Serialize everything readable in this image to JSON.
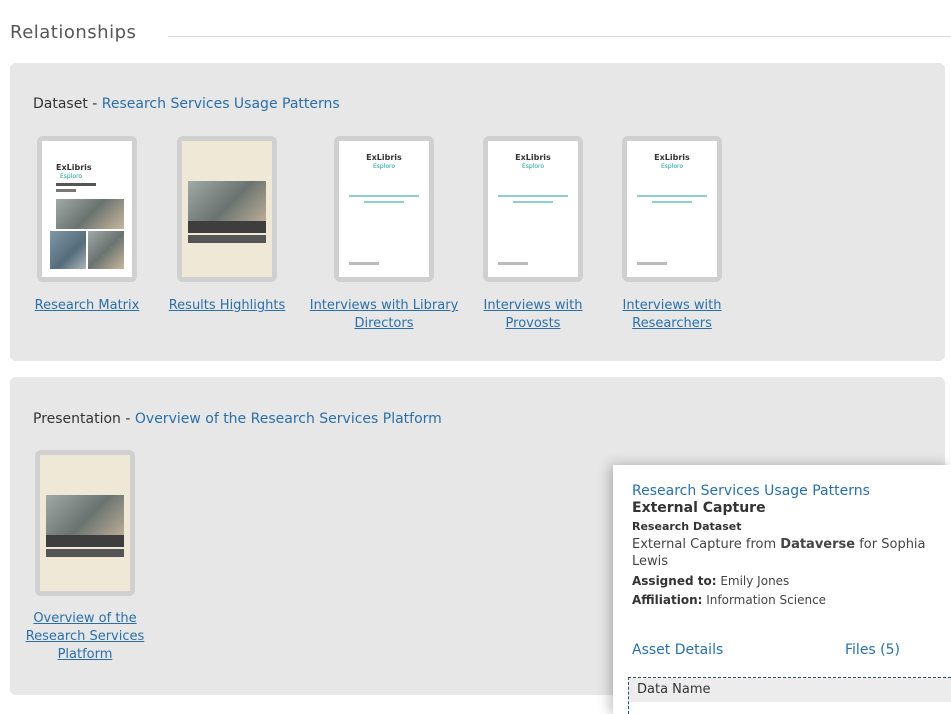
{
  "section": {
    "title": "Relationships"
  },
  "dataset": {
    "prefix": "Dataset - ",
    "title": "Research Services Usage Patterns",
    "items": [
      {
        "label": "Research Matrix",
        "thumb": "research-matrix"
      },
      {
        "label": "Results Highlights",
        "thumb": "results-highlights"
      },
      {
        "label": "Interviews with Library Directors",
        "thumb": "exlibris-doc"
      },
      {
        "label": "Interviews with Provosts",
        "thumb": "exlibris-doc"
      },
      {
        "label": "Interviews with Researchers",
        "thumb": "exlibris-doc"
      }
    ]
  },
  "presentation": {
    "prefix": "Presentation - ",
    "title": "Overview of the Research Services Platform",
    "items": [
      {
        "label": "Overview of the Research Services Platform",
        "thumb": "results-highlights"
      }
    ]
  },
  "popover": {
    "title": "Research Services Usage Patterns",
    "subtitle": "External Capture",
    "type": "Research Dataset",
    "description_prefix": "External Capture from ",
    "description_source": "Dataverse",
    "description_suffix": " for Sophia Lewis",
    "assigned_label": "Assigned to:",
    "assigned_value": " Emily Jones",
    "affiliation_label": "Affiliation:",
    "affiliation_value": " Information Science",
    "asset_details": "Asset Details",
    "files": "Files (5)",
    "table_header": "Data Name"
  },
  "colors": {
    "link": "#2a6faa",
    "panel": "#e7e7e7",
    "thumb_frame": "#d0d0d0"
  }
}
